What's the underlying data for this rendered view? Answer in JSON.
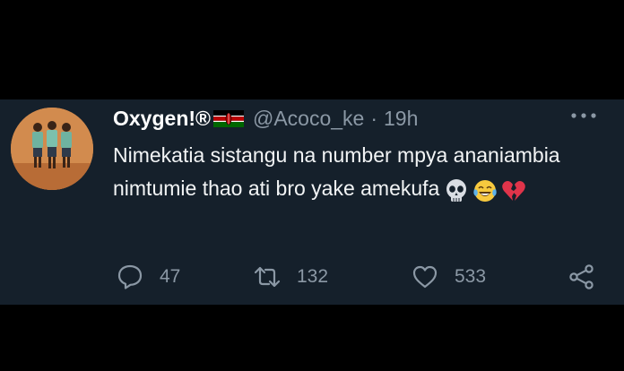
{
  "tweet": {
    "display_name": "Oxygen!®",
    "handle": "@Acoco_ke",
    "separator": "·",
    "time": "19h",
    "text": "Nimekatia sistangu na number mpya ananiambia nimtumie thao ati bro yake amekufa",
    "flag_icon": "kenya-flag-icon",
    "emojis": [
      "skull-icon",
      "face-with-tears-of-joy-icon",
      "broken-heart-icon"
    ],
    "actions": {
      "reply_count": "47",
      "retweet_count": "132",
      "like_count": "533"
    }
  },
  "colors": {
    "tweet_background": "#15202b",
    "outer_background": "#000000",
    "primary_text": "#ffffff",
    "secondary_text": "#8b98a5"
  }
}
